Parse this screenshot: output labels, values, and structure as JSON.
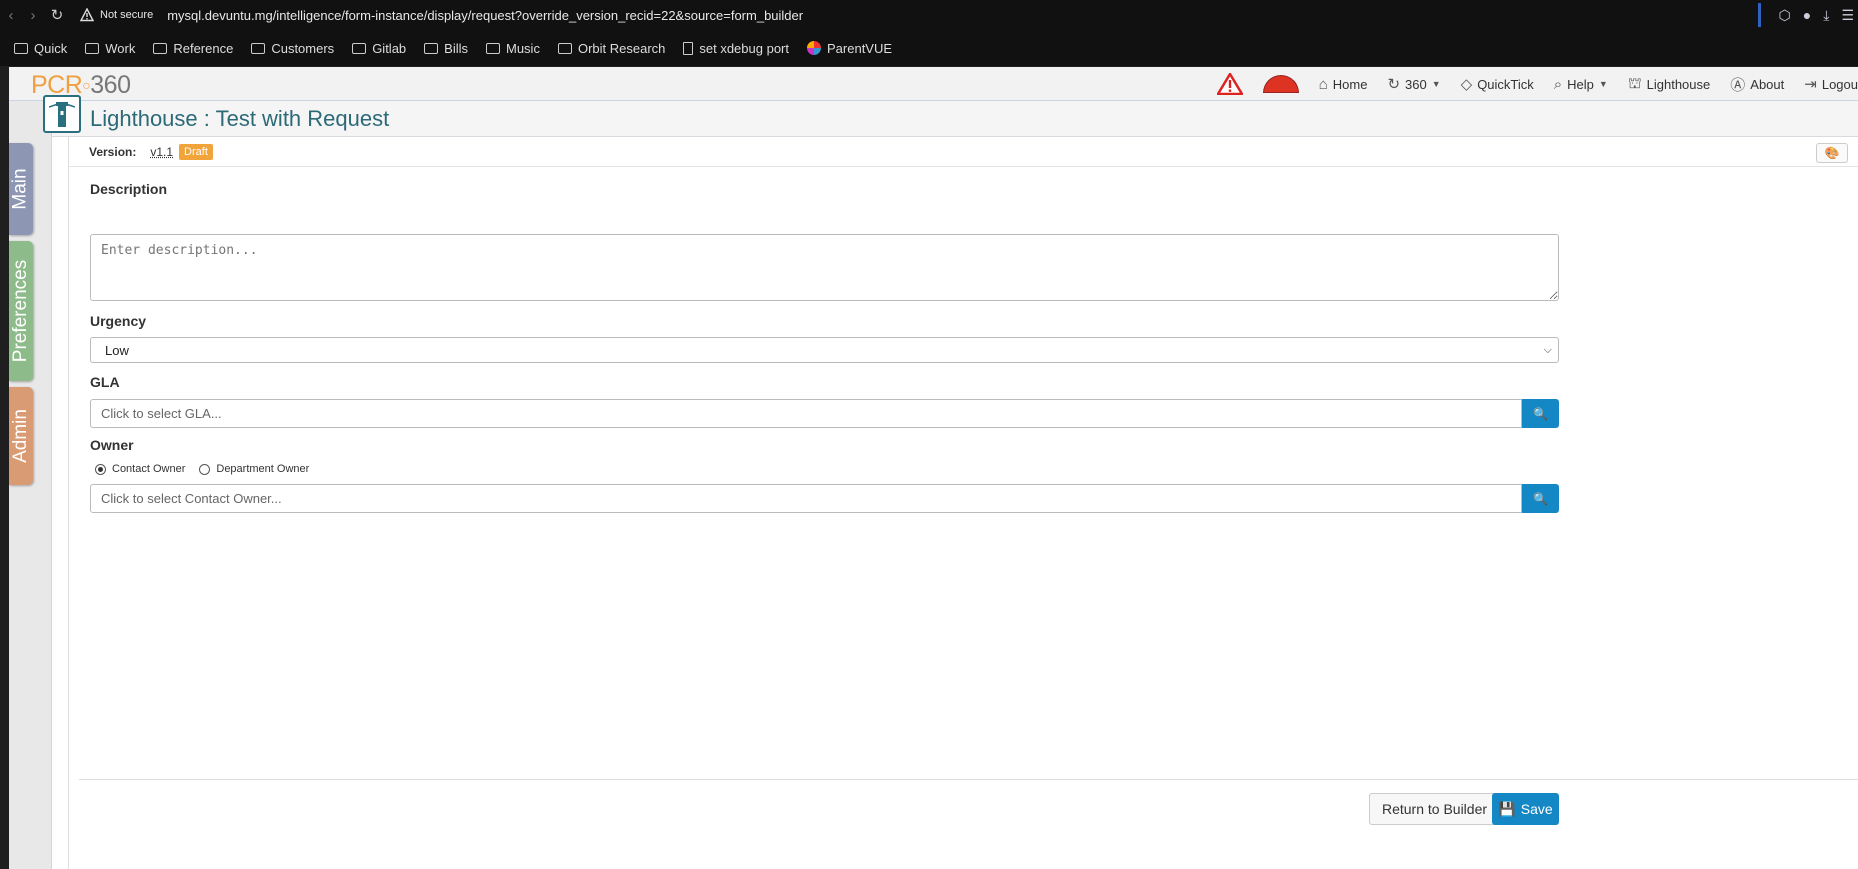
{
  "browser": {
    "security_label": "Not secure",
    "url": "mysql.devuntu.mg/intelligence/form-instance/display/request?override_version_recid=22&source=form_builder",
    "bookmarks": [
      {
        "label": "Quick",
        "icon": "folder-icon"
      },
      {
        "label": "Work",
        "icon": "folder-icon"
      },
      {
        "label": "Reference",
        "icon": "folder-icon"
      },
      {
        "label": "Customers",
        "icon": "folder-icon"
      },
      {
        "label": "Gitlab",
        "icon": "folder-icon"
      },
      {
        "label": "Bills",
        "icon": "folder-icon"
      },
      {
        "label": "Music",
        "icon": "folder-icon"
      },
      {
        "label": "Orbit Research",
        "icon": "folder-icon"
      },
      {
        "label": "set xdebug port",
        "icon": "page-icon"
      },
      {
        "label": "ParentVUE",
        "icon": "parentvue-icon"
      }
    ]
  },
  "app": {
    "logo_pcr": "PCR",
    "logo_num": "360",
    "nav": {
      "home": "Home",
      "three60": "360",
      "quicktick": "QuickTick",
      "help": "Help",
      "lighthouse": "Lighthouse",
      "about": "About",
      "logout": "Logou"
    },
    "side_tabs": {
      "main": "Main",
      "preferences": "Preferences",
      "admin": "Admin"
    }
  },
  "page": {
    "title": "Lighthouse : Test with Request",
    "version_label": "Version:",
    "version_value": "v1.1",
    "version_status": "Draft"
  },
  "form": {
    "description": {
      "label": "Description",
      "placeholder": "Enter description..."
    },
    "urgency": {
      "label": "Urgency",
      "value": "Low"
    },
    "gla": {
      "label": "GLA",
      "placeholder": "Click to select GLA..."
    },
    "owner": {
      "label": "Owner",
      "option_contact": "Contact Owner",
      "option_department": "Department Owner",
      "selected": "Contact Owner",
      "placeholder": "Click to select Contact Owner..."
    },
    "buttons": {
      "return": "Return to Builder",
      "save": "Save"
    }
  },
  "colors": {
    "accent": "#1488c4",
    "title": "#2c6a78",
    "draft_badge": "#f0a43a"
  }
}
